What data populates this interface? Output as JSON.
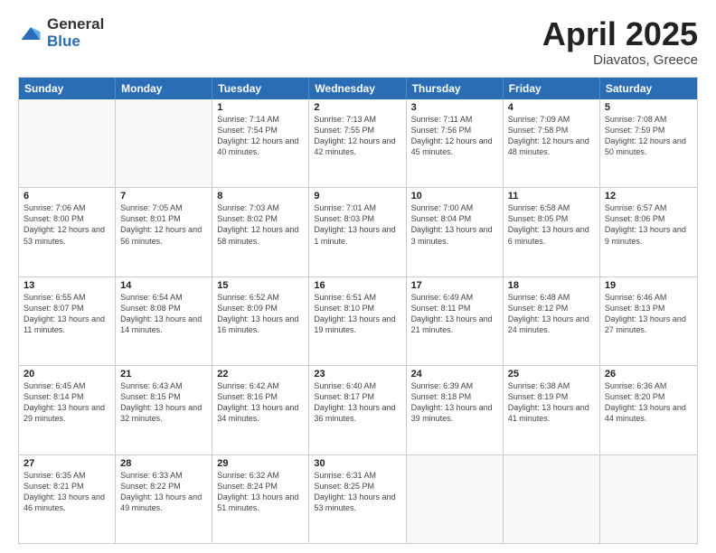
{
  "logo": {
    "general": "General",
    "blue": "Blue"
  },
  "title": {
    "month": "April 2025",
    "location": "Diavatos, Greece"
  },
  "days_of_week": [
    "Sunday",
    "Monday",
    "Tuesday",
    "Wednesday",
    "Thursday",
    "Friday",
    "Saturday"
  ],
  "weeks": [
    [
      {
        "day": "",
        "empty": true
      },
      {
        "day": "",
        "empty": true
      },
      {
        "day": "1",
        "sunrise": "7:14 AM",
        "sunset": "7:54 PM",
        "daylight": "12 hours and 40 minutes."
      },
      {
        "day": "2",
        "sunrise": "7:13 AM",
        "sunset": "7:55 PM",
        "daylight": "12 hours and 42 minutes."
      },
      {
        "day": "3",
        "sunrise": "7:11 AM",
        "sunset": "7:56 PM",
        "daylight": "12 hours and 45 minutes."
      },
      {
        "day": "4",
        "sunrise": "7:09 AM",
        "sunset": "7:58 PM",
        "daylight": "12 hours and 48 minutes."
      },
      {
        "day": "5",
        "sunrise": "7:08 AM",
        "sunset": "7:59 PM",
        "daylight": "12 hours and 50 minutes."
      }
    ],
    [
      {
        "day": "6",
        "sunrise": "7:06 AM",
        "sunset": "8:00 PM",
        "daylight": "12 hours and 53 minutes."
      },
      {
        "day": "7",
        "sunrise": "7:05 AM",
        "sunset": "8:01 PM",
        "daylight": "12 hours and 56 minutes."
      },
      {
        "day": "8",
        "sunrise": "7:03 AM",
        "sunset": "8:02 PM",
        "daylight": "12 hours and 58 minutes."
      },
      {
        "day": "9",
        "sunrise": "7:01 AM",
        "sunset": "8:03 PM",
        "daylight": "13 hours and 1 minute."
      },
      {
        "day": "10",
        "sunrise": "7:00 AM",
        "sunset": "8:04 PM",
        "daylight": "13 hours and 3 minutes."
      },
      {
        "day": "11",
        "sunrise": "6:58 AM",
        "sunset": "8:05 PM",
        "daylight": "13 hours and 6 minutes."
      },
      {
        "day": "12",
        "sunrise": "6:57 AM",
        "sunset": "8:06 PM",
        "daylight": "13 hours and 9 minutes."
      }
    ],
    [
      {
        "day": "13",
        "sunrise": "6:55 AM",
        "sunset": "8:07 PM",
        "daylight": "13 hours and 11 minutes."
      },
      {
        "day": "14",
        "sunrise": "6:54 AM",
        "sunset": "8:08 PM",
        "daylight": "13 hours and 14 minutes."
      },
      {
        "day": "15",
        "sunrise": "6:52 AM",
        "sunset": "8:09 PM",
        "daylight": "13 hours and 16 minutes."
      },
      {
        "day": "16",
        "sunrise": "6:51 AM",
        "sunset": "8:10 PM",
        "daylight": "13 hours and 19 minutes."
      },
      {
        "day": "17",
        "sunrise": "6:49 AM",
        "sunset": "8:11 PM",
        "daylight": "13 hours and 21 minutes."
      },
      {
        "day": "18",
        "sunrise": "6:48 AM",
        "sunset": "8:12 PM",
        "daylight": "13 hours and 24 minutes."
      },
      {
        "day": "19",
        "sunrise": "6:46 AM",
        "sunset": "8:13 PM",
        "daylight": "13 hours and 27 minutes."
      }
    ],
    [
      {
        "day": "20",
        "sunrise": "6:45 AM",
        "sunset": "8:14 PM",
        "daylight": "13 hours and 29 minutes."
      },
      {
        "day": "21",
        "sunrise": "6:43 AM",
        "sunset": "8:15 PM",
        "daylight": "13 hours and 32 minutes."
      },
      {
        "day": "22",
        "sunrise": "6:42 AM",
        "sunset": "8:16 PM",
        "daylight": "13 hours and 34 minutes."
      },
      {
        "day": "23",
        "sunrise": "6:40 AM",
        "sunset": "8:17 PM",
        "daylight": "13 hours and 36 minutes."
      },
      {
        "day": "24",
        "sunrise": "6:39 AM",
        "sunset": "8:18 PM",
        "daylight": "13 hours and 39 minutes."
      },
      {
        "day": "25",
        "sunrise": "6:38 AM",
        "sunset": "8:19 PM",
        "daylight": "13 hours and 41 minutes."
      },
      {
        "day": "26",
        "sunrise": "6:36 AM",
        "sunset": "8:20 PM",
        "daylight": "13 hours and 44 minutes."
      }
    ],
    [
      {
        "day": "27",
        "sunrise": "6:35 AM",
        "sunset": "8:21 PM",
        "daylight": "13 hours and 46 minutes."
      },
      {
        "day": "28",
        "sunrise": "6:33 AM",
        "sunset": "8:22 PM",
        "daylight": "13 hours and 49 minutes."
      },
      {
        "day": "29",
        "sunrise": "6:32 AM",
        "sunset": "8:24 PM",
        "daylight": "13 hours and 51 minutes."
      },
      {
        "day": "30",
        "sunrise": "6:31 AM",
        "sunset": "8:25 PM",
        "daylight": "13 hours and 53 minutes."
      },
      {
        "day": "",
        "empty": true
      },
      {
        "day": "",
        "empty": true
      },
      {
        "day": "",
        "empty": true
      }
    ]
  ]
}
